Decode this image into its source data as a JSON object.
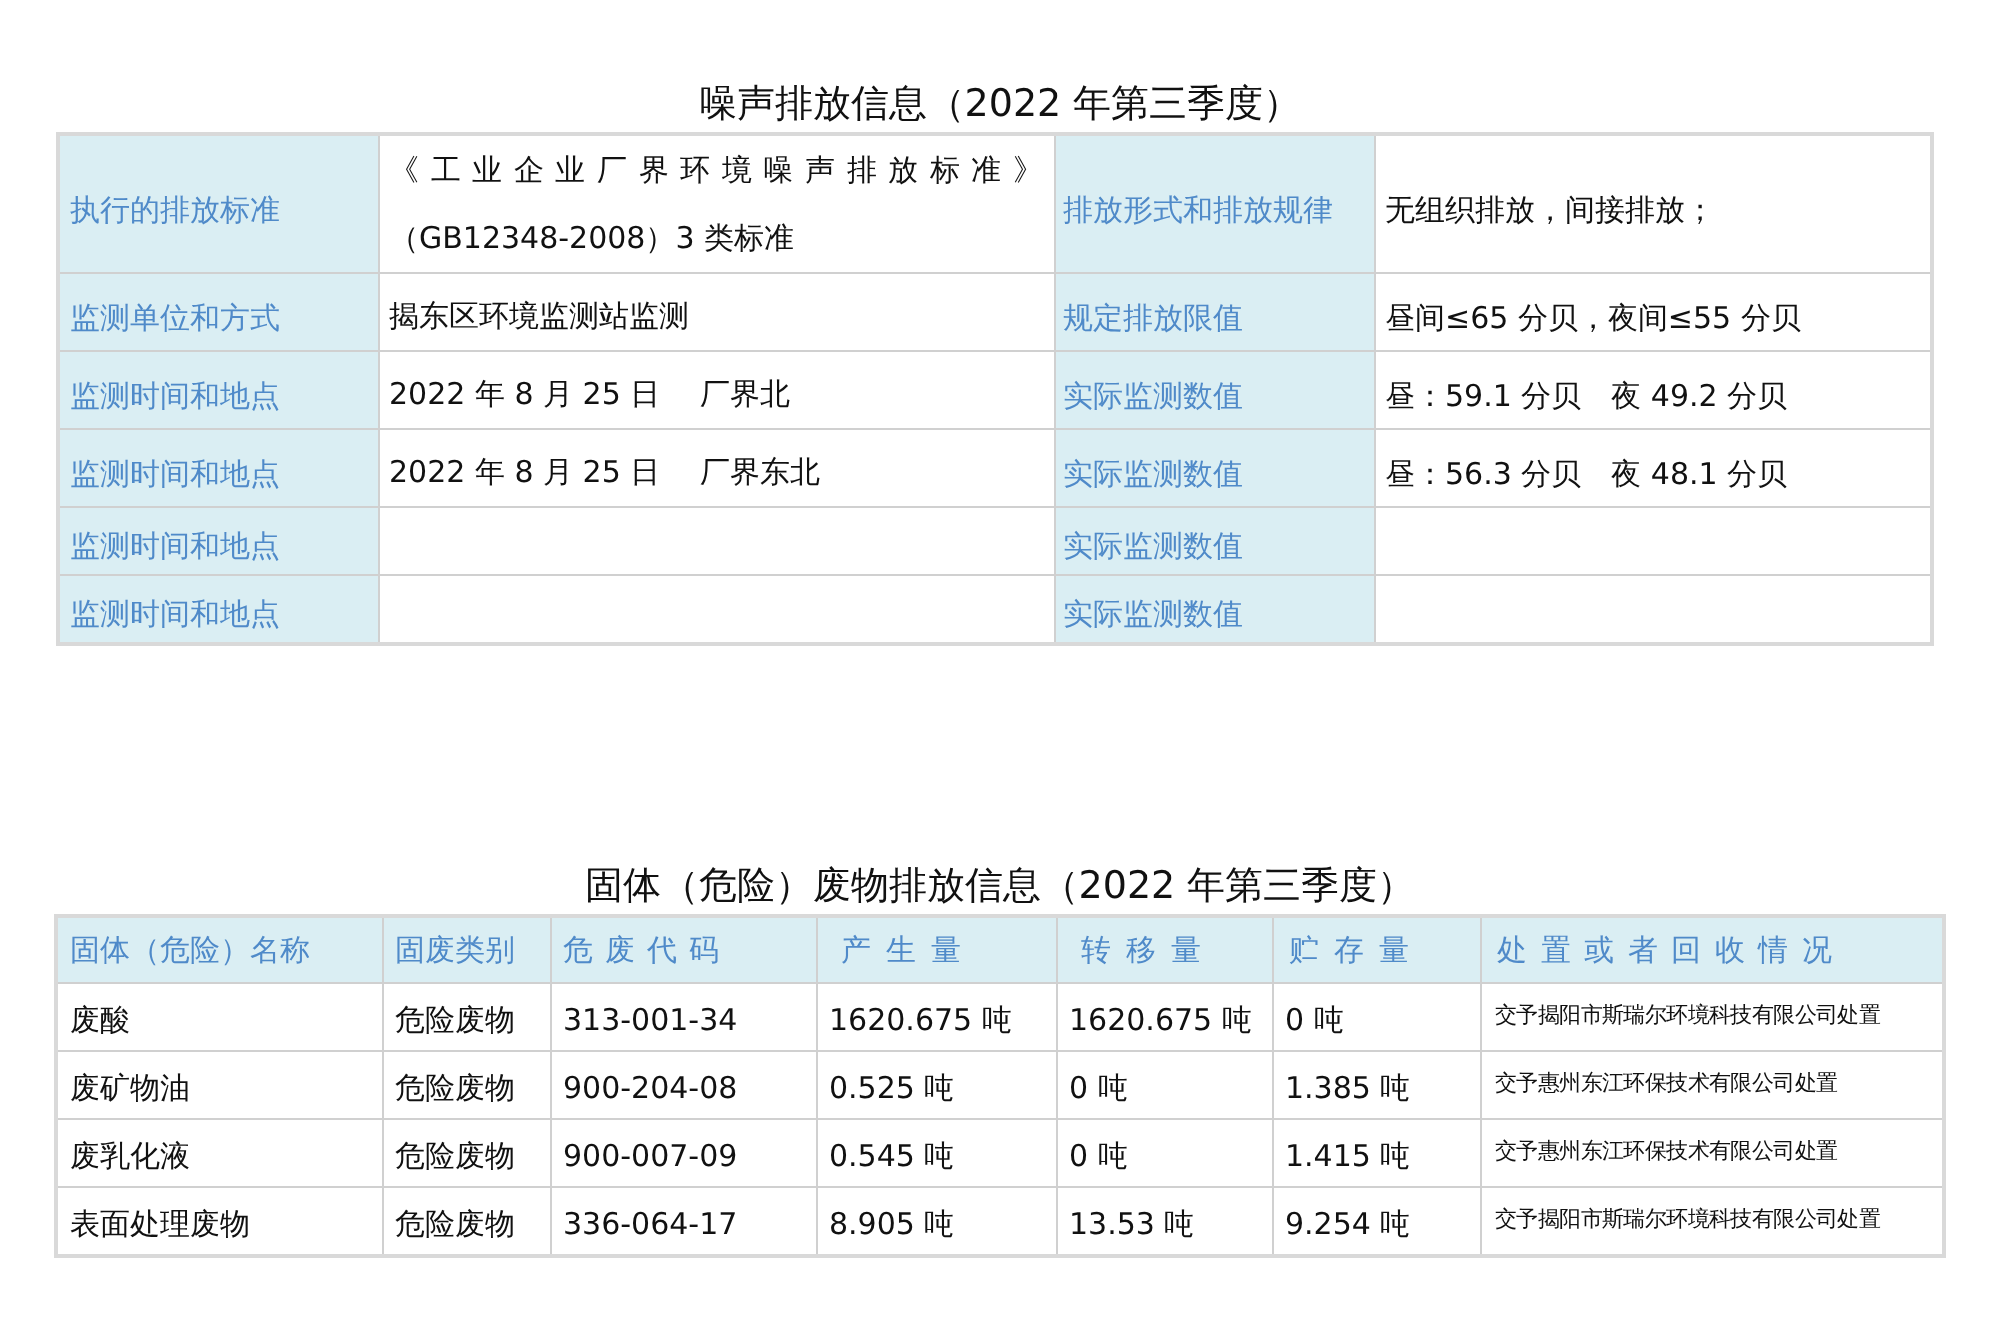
{
  "noise": {
    "title": "噪声排放信息（2022 年第三季度）",
    "rows": [
      {
        "label": "执行的排放标准",
        "value": "《工业企业厂界环境噪声排放标准》（GB12348-2008）3 类标准",
        "label2": "排放形式和排放规律",
        "value2": "无组织排放，间接排放；"
      },
      {
        "label": "监测单位和方式",
        "value": "揭东区环境监测站监测",
        "label2": "规定排放限值",
        "value2": "昼间≤65 分贝，夜间≤55 分贝"
      },
      {
        "label": "监测时间和地点",
        "value": "2022 年 8 月 25 日　 厂界北",
        "label2": "实际监测数值",
        "value2": "昼：59.1 分贝　夜 49.2 分贝"
      },
      {
        "label": "监测时间和地点",
        "value": "2022 年 8 月 25 日　 厂界东北",
        "label2": "实际监测数值",
        "value2": "昼：56.3 分贝　夜 48.1 分贝"
      },
      {
        "label": "监测时间和地点",
        "label2": "实际监测数值"
      },
      {
        "label": "监测时间和地点",
        "label2": "实际监测数值"
      }
    ]
  },
  "waste": {
    "title": "固体（危险）废物排放信息（2022 年第三季度）",
    "columns": [
      "固体（危险）名称",
      "固废类别",
      "危废代码",
      "产生量",
      "转移量",
      "贮存量",
      "处置或者回收情况"
    ],
    "rows": [
      [
        "废酸",
        "危险废物",
        "313-001-34",
        "1620.675 吨",
        "1620.675 吨",
        "0 吨",
        "交予揭阳市斯瑞尔环境科技有限公司处置"
      ],
      [
        "废矿物油",
        "危险废物",
        "900-204-08",
        "0.525 吨",
        "0 吨",
        "1.385 吨",
        "交予惠州东江环保技术有限公司处置"
      ],
      [
        "废乳化液",
        "危险废物",
        "900-007-09",
        "0.545 吨",
        "0 吨",
        "1.415 吨",
        "交予惠州东江环保技术有限公司处置"
      ],
      [
        "表面处理废物",
        "危险废物",
        "336-064-17",
        "8.905 吨",
        "13.53 吨",
        "9.254 吨",
        "交予揭阳市斯瑞尔环境科技有限公司处置"
      ]
    ]
  }
}
